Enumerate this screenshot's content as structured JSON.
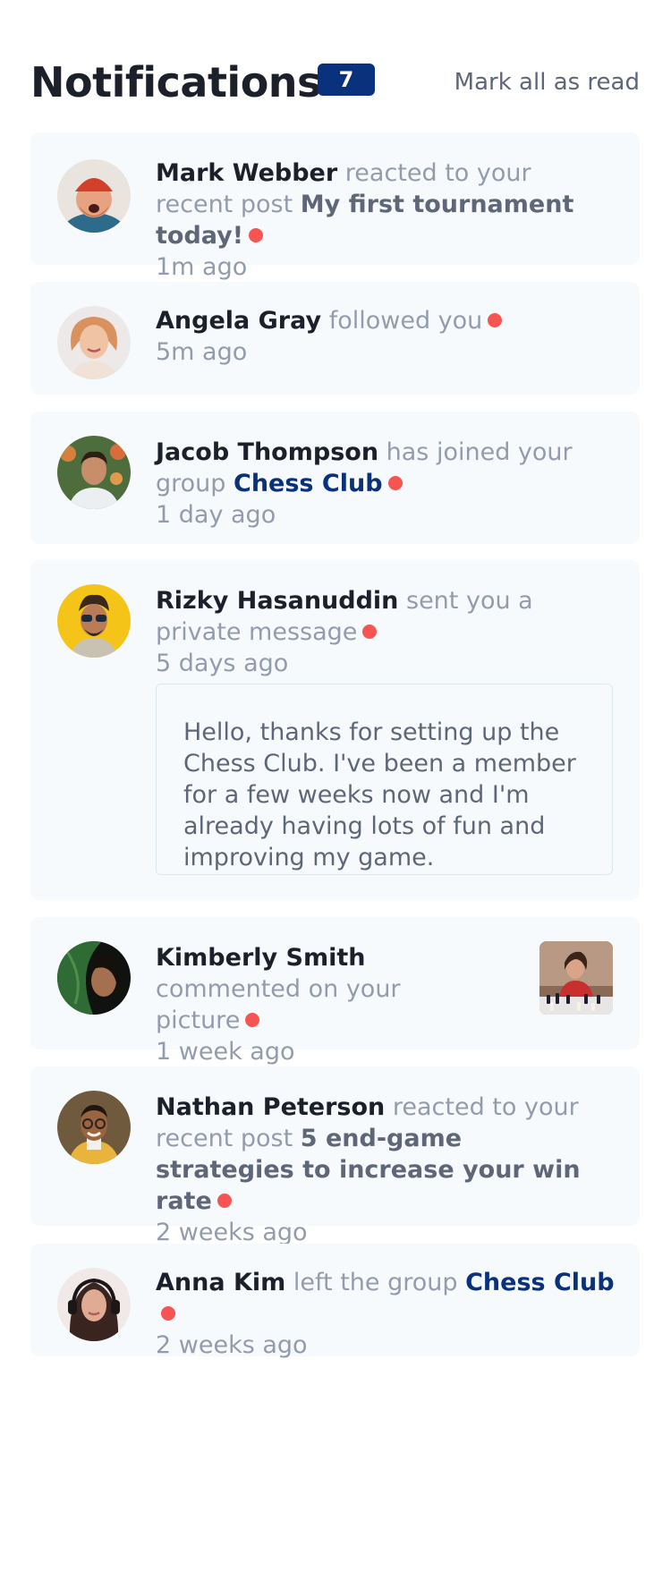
{
  "header": {
    "title": "Notifications",
    "badge_count": "7",
    "mark_all_label": "Mark all as read"
  },
  "notifications": [
    {
      "name": "Mark Webber",
      "action": "reacted to your recent post",
      "post": "My first tournament today!",
      "time": "1m ago",
      "unread": true,
      "avatar": "avatar-mark-webber"
    },
    {
      "name": "Angela Gray",
      "action": "followed you",
      "time": "5m ago",
      "unread": true,
      "avatar": "avatar-angela-gray"
    },
    {
      "name": "Jacob Thompson",
      "action": "has joined your group",
      "group": "Chess Club",
      "time": "1 day ago",
      "unread": true,
      "avatar": "avatar-jacob-thompson"
    },
    {
      "name": "Rizky Hasanuddin",
      "action": "sent you a private message",
      "time": "5 days ago",
      "unread": true,
      "avatar": "avatar-rizky-hasanuddin",
      "message": "Hello, thanks for setting up the Chess Club. I've been a member for a few weeks now and I'm already having lots of fun and improving my game."
    },
    {
      "name": "Kimberly Smith",
      "action": "commented on your picture",
      "time": "1 week ago",
      "unread": true,
      "avatar": "avatar-kimberly-smith",
      "picture": "chess-picture-thumbnail"
    },
    {
      "name": "Nathan Peterson",
      "action": "reacted to your recent post",
      "post": "5 end-game strategies to increase your win rate",
      "time": "2 weeks ago",
      "unread": true,
      "avatar": "avatar-nathan-peterson"
    },
    {
      "name": "Anna Kim",
      "action": "left the group",
      "group": "Chess Club",
      "time": "2 weeks ago",
      "unread": true,
      "avatar": "avatar-anna-kim"
    }
  ],
  "colors": {
    "primary_blue": "#0a317b",
    "unread_dot": "#f65552",
    "card_bg": "#f7fafd",
    "dark_text": "#1c202b",
    "grayish_blue": "#5e6778",
    "light_grayish_blue": "#939cad"
  }
}
